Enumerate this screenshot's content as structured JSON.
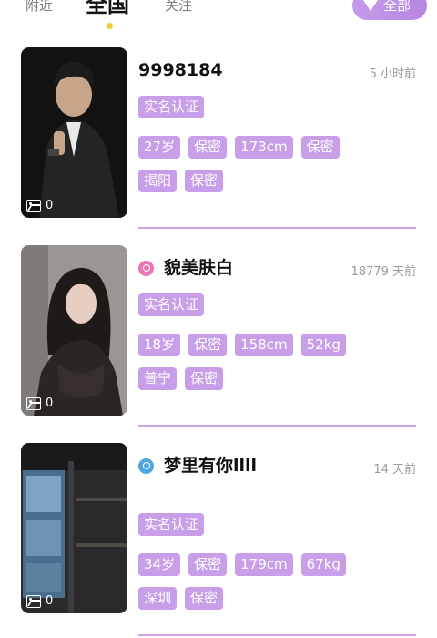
{
  "tabs": {
    "nearby": "附近",
    "all": "全国",
    "follow": "关注"
  },
  "filter": {
    "label": "全部",
    "icon": "caret-down-icon"
  },
  "colors": {
    "accent": "#c89ee8",
    "divider": "#cfa7e8",
    "tab_dot": "#f1cf33",
    "female": "#e877b4",
    "male": "#4da6de"
  },
  "profiles": [
    {
      "name": "9998184",
      "time": "5 小时前",
      "gender": "none",
      "photo_count": "0",
      "verified": "实名认证",
      "stats": [
        "27岁",
        "保密",
        "173cm",
        "保密"
      ],
      "place": [
        "揭阳",
        "保密"
      ]
    },
    {
      "name": "貌美肤白",
      "time": "18779 天前",
      "gender": "female",
      "photo_count": "0",
      "verified": "实名认证",
      "stats": [
        "18岁",
        "保密",
        "158cm",
        "52kg"
      ],
      "place": [
        "普宁",
        "保密"
      ]
    },
    {
      "name": "梦里有你llll",
      "time": "14 天前",
      "gender": "male",
      "photo_count": "0",
      "verified": "实名认证",
      "stats": [
        "34岁",
        "保密",
        "179cm",
        "67kg"
      ],
      "place": [
        "深圳",
        "保密"
      ]
    }
  ]
}
